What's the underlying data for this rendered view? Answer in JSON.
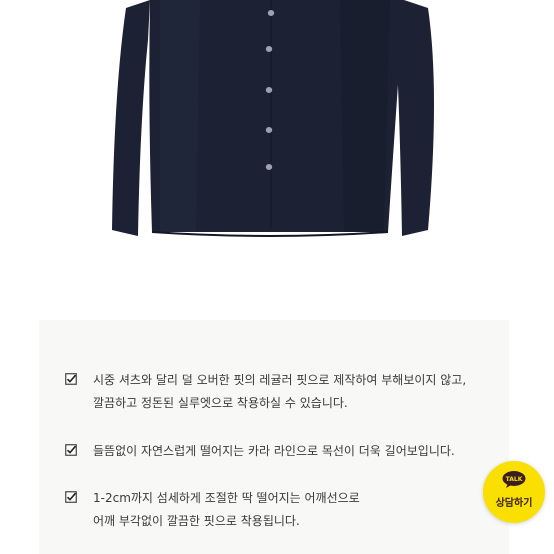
{
  "product": {
    "image_icon": "navy-shirt-photo",
    "shirt_color": "#1c2233"
  },
  "description": {
    "features": [
      {
        "icon": "checkbox-icon",
        "text": "시중 셔츠와 달리 덜 오버한 핏의 레귤러 핏으로 제작하여 부해보이지 않고,\n깔끔하고 정돈된 실루엣으로 착용하실 수 있습니다."
      },
      {
        "icon": "checkbox-icon",
        "text": "들뜸없이 자연스럽게 떨어지는 카라 라인으로 목선이 더욱 길어보입니다."
      },
      {
        "icon": "checkbox-icon",
        "text": "1-2cm까지 섬세하게 조절한 딱 떨어지는 어깨선으로\n어깨 부각없이 깔끔한 핏으로 착용됩니다."
      }
    ]
  },
  "kakao": {
    "bubble_text": "TALK",
    "label": "상담하기",
    "color": "#f9e000"
  }
}
